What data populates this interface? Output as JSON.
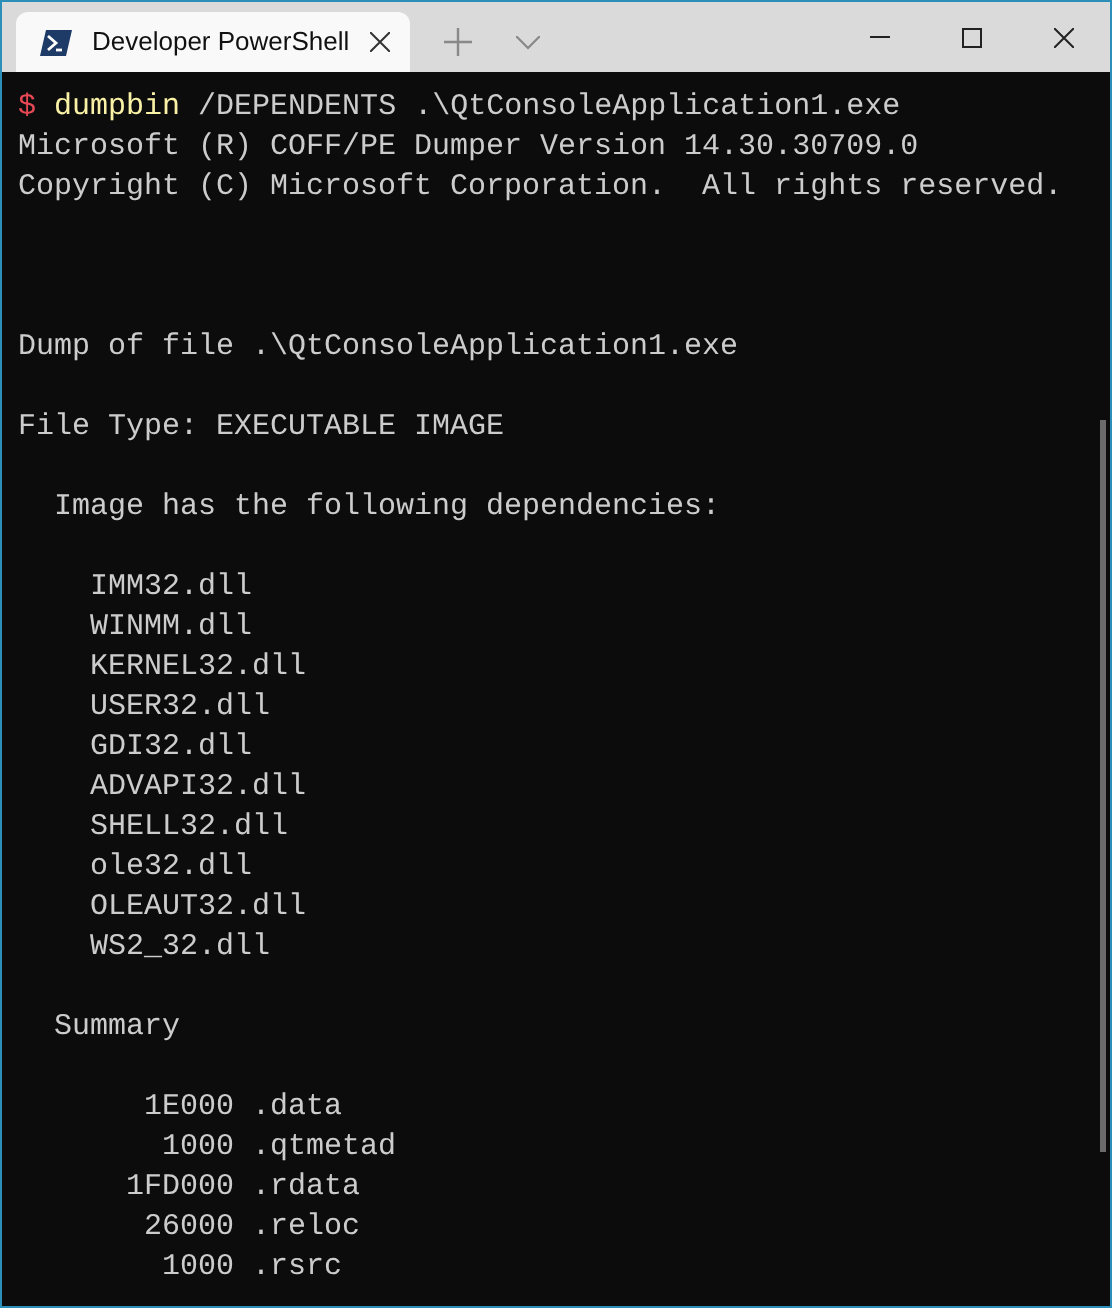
{
  "window": {
    "tab": {
      "title": "Developer PowerShell",
      "selected": true
    }
  },
  "terminal": {
    "lines": [
      {
        "kind": "prompt",
        "symbol": "$",
        "command": "dumpbin",
        "args": " /DEPENDENTS .\\QtConsoleApplication1.exe"
      },
      {
        "kind": "text",
        "text": "Microsoft (R) COFF/PE Dumper Version 14.30.30709.0"
      },
      {
        "kind": "text",
        "text": "Copyright (C) Microsoft Corporation.  All rights reserved."
      },
      {
        "kind": "blank"
      },
      {
        "kind": "blank"
      },
      {
        "kind": "blank"
      },
      {
        "kind": "text",
        "text": "Dump of file .\\QtConsoleApplication1.exe"
      },
      {
        "kind": "blank"
      },
      {
        "kind": "text",
        "text": "File Type: EXECUTABLE IMAGE"
      },
      {
        "kind": "blank"
      },
      {
        "kind": "text",
        "text": "  Image has the following dependencies:"
      },
      {
        "kind": "blank"
      },
      {
        "kind": "text",
        "text": "    IMM32.dll"
      },
      {
        "kind": "text",
        "text": "    WINMM.dll"
      },
      {
        "kind": "text",
        "text": "    KERNEL32.dll"
      },
      {
        "kind": "text",
        "text": "    USER32.dll"
      },
      {
        "kind": "text",
        "text": "    GDI32.dll"
      },
      {
        "kind": "text",
        "text": "    ADVAPI32.dll"
      },
      {
        "kind": "text",
        "text": "    SHELL32.dll"
      },
      {
        "kind": "text",
        "text": "    ole32.dll"
      },
      {
        "kind": "text",
        "text": "    OLEAUT32.dll"
      },
      {
        "kind": "text",
        "text": "    WS2_32.dll"
      },
      {
        "kind": "blank"
      },
      {
        "kind": "text",
        "text": "  Summary"
      },
      {
        "kind": "blank"
      },
      {
        "kind": "text",
        "text": "       1E000 .data"
      },
      {
        "kind": "text",
        "text": "        1000 .qtmetad"
      },
      {
        "kind": "text",
        "text": "      1FD000 .rdata"
      },
      {
        "kind": "text",
        "text": "       26000 .reloc"
      },
      {
        "kind": "text",
        "text": "        1000 .rsrc"
      }
    ]
  }
}
